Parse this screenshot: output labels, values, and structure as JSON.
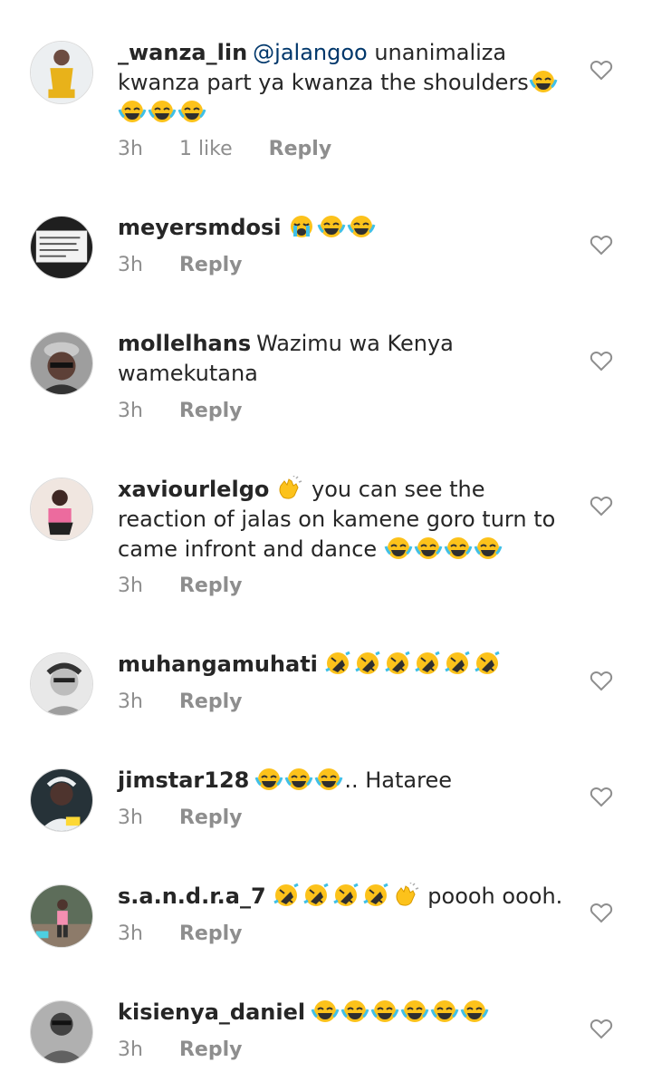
{
  "comments": [
    {
      "username": "_wanza_lin",
      "mention": "@jalangoo",
      "text": " unanimaliza kwanza part ya kwanza the shoulders",
      "emojis_after": [
        "joy",
        "joy",
        "joy",
        "joy"
      ],
      "time": "3h",
      "likes": "1 like",
      "reply": "Reply"
    },
    {
      "username": "meyersmdosi",
      "text": "",
      "emojis_after": [
        "sob",
        "joy",
        "joy"
      ],
      "time": "3h",
      "reply": "Reply"
    },
    {
      "username": "mollelhans",
      "text": "Wazimu wa Kenya wamekutana",
      "emojis_after": [],
      "time": "3h",
      "reply": "Reply"
    },
    {
      "username": "xaviourlelgo",
      "emojis_before": [
        "clap"
      ],
      "text": " you can see the reaction of jalas on kamene goro turn to came infront and dance ",
      "emojis_after": [
        "joy",
        "joy",
        "joy",
        "joy"
      ],
      "time": "3h",
      "reply": "Reply"
    },
    {
      "username": "muhangamuhati",
      "text": "",
      "emojis_after": [
        "rofl",
        "rofl",
        "rofl",
        "rofl",
        "rofl",
        "rofl"
      ],
      "time": "3h",
      "reply": "Reply"
    },
    {
      "username": "jimstar128",
      "emojis_before": [
        "joy",
        "joy",
        "joy"
      ],
      "text": ".. Hataree",
      "emojis_after": [],
      "time": "3h",
      "reply": "Reply"
    },
    {
      "username": "s.a.n.d.r.a_7",
      "emojis_before": [
        "rofl",
        "rofl",
        "rofl",
        "rofl",
        "clap"
      ],
      "text": " poooh oooh.",
      "emojis_after": [],
      "time": "3h",
      "reply": "Reply"
    },
    {
      "username": "kisienya_daniel",
      "text": "",
      "emojis_after": [
        "joy",
        "joy",
        "joy",
        "joy",
        "joy",
        "joy"
      ],
      "time": "3h",
      "reply": "Reply"
    }
  ],
  "icons": {
    "like": "heart-outline-icon"
  },
  "colors": {
    "mention": "#00376b",
    "muted": "#8e8e8e",
    "text": "#262626"
  }
}
